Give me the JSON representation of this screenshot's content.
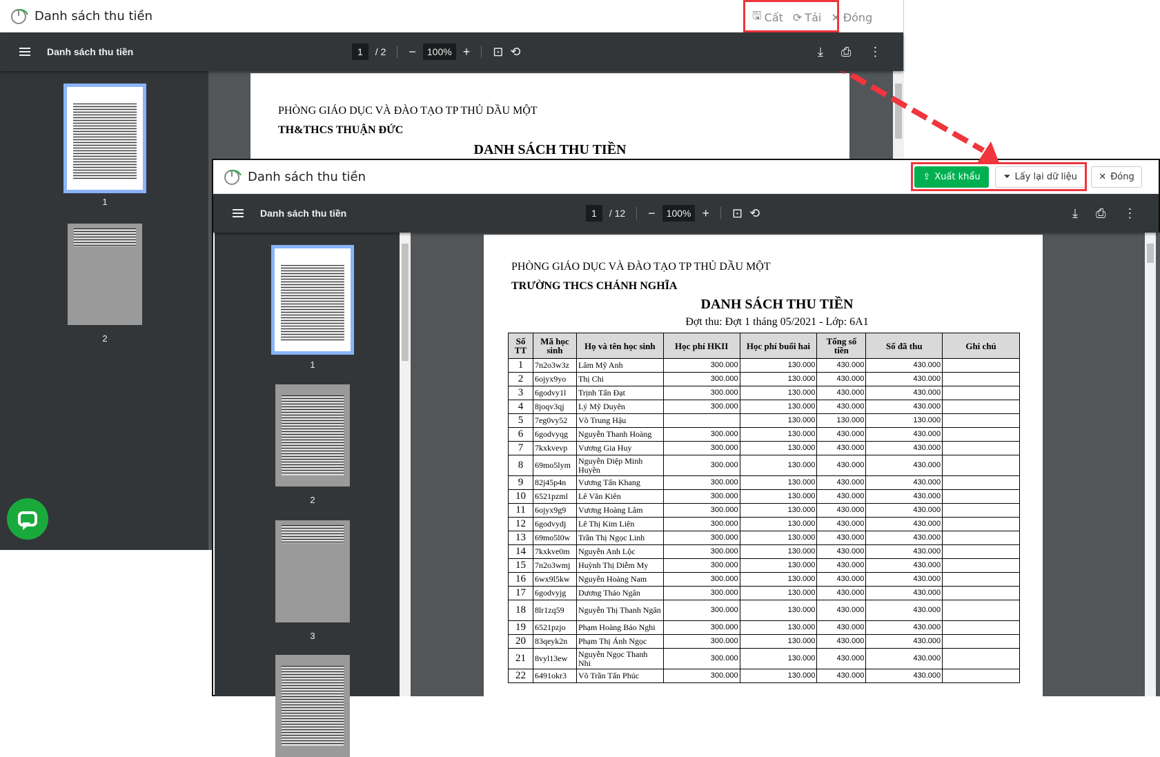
{
  "back_window": {
    "title": "Danh sách thu tiền",
    "actions": {
      "save": "Cất",
      "reload": "Tải",
      "close": "Đóng"
    },
    "toolbar": {
      "title": "Danh sách thu tiền",
      "page": "1",
      "total": "/ 2",
      "zoom": "100%"
    },
    "thumbnails": [
      "1",
      "2"
    ],
    "page": {
      "line1": "PHÒNG GIÁO DỤC VÀ ĐÀO TẠO TP THỦ DẦU MỘT",
      "line2": "TH&THCS THUẬN ĐỨC",
      "title": "DANH SÁCH THU TIỀN"
    }
  },
  "front_window": {
    "title": "Danh sách thu tiền",
    "actions": {
      "export": "Xuất khẩu",
      "reload": "Lấy lại dữ liệu",
      "close": "Đóng"
    },
    "toolbar": {
      "title": "Danh sách thu tiền",
      "page": "1",
      "total": "/ 12",
      "zoom": "100%"
    },
    "thumbnails": [
      "1",
      "2",
      "3"
    ],
    "page": {
      "line1": "PHÒNG GIÁO DỤC VÀ ĐÀO TẠO TP THỦ DẦU MỘT",
      "line2": "TRƯỜNG THCS CHÁNH NGHĨA",
      "title": "DANH SÁCH THU TIỀN",
      "subtitle": "Đợt thu: Đợt 1 tháng 05/2021 - Lớp: 6A1"
    },
    "table": {
      "columns": [
        "Số TT",
        "Mã học sinh",
        "Họ và tên học sinh",
        "Học phí HKII",
        "Học phí buổi hai",
        "Tổng số tiền",
        "Số đã thu",
        "Ghi chú"
      ],
      "rows": [
        [
          "1",
          "7n2o3w3z",
          "Lâm Mỹ Anh",
          "300.000",
          "130.000",
          "430.000",
          "430.000",
          ""
        ],
        [
          "2",
          "6ojyx9yo",
          "Thị Chi",
          "300.000",
          "130.000",
          "430.000",
          "430.000",
          ""
        ],
        [
          "3",
          "6godvy1l",
          "Trịnh Tấn Đạt",
          "300.000",
          "130.000",
          "430.000",
          "430.000",
          ""
        ],
        [
          "4",
          "8joqv3qj",
          "Lý Mỹ Duyên",
          "300.000",
          "130.000",
          "430.000",
          "430.000",
          ""
        ],
        [
          "5",
          "7eg0vy52",
          "Võ Trung Hậu",
          "",
          "130.000",
          "130.000",
          "130.000",
          ""
        ],
        [
          "6",
          "6godvyqg",
          "Nguyễn Thanh Hoàng",
          "300.000",
          "130.000",
          "430.000",
          "430.000",
          ""
        ],
        [
          "7",
          "7kxkvevp",
          "Vương Gia Huy",
          "300.000",
          "130.000",
          "430.000",
          "430.000",
          ""
        ],
        [
          "8",
          "69mo5lym",
          "Nguyễn Diệp Minh Huyền",
          "300.000",
          "130.000",
          "430.000",
          "430.000",
          ""
        ],
        [
          "9",
          "82j45p4n",
          "Vương Tấn Khang",
          "300.000",
          "130.000",
          "430.000",
          "430.000",
          ""
        ],
        [
          "10",
          "6521pzml",
          "Lê Văn Kiên",
          "300.000",
          "130.000",
          "430.000",
          "430.000",
          ""
        ],
        [
          "11",
          "6ojyx9g9",
          "Vương Hoàng Lâm",
          "300.000",
          "130.000",
          "430.000",
          "430.000",
          ""
        ],
        [
          "12",
          "6godvydj",
          "Lê Thị Kim Liên",
          "300.000",
          "130.000",
          "430.000",
          "430.000",
          ""
        ],
        [
          "13",
          "69mo5l0w",
          "Trần Thị Ngọc Linh",
          "300.000",
          "130.000",
          "430.000",
          "430.000",
          ""
        ],
        [
          "14",
          "7kxkve0m",
          "Nguyễn Anh Lộc",
          "300.000",
          "130.000",
          "430.000",
          "430.000",
          ""
        ],
        [
          "15",
          "7n2o3wmj",
          "Huỳnh Thị Diễm My",
          "300.000",
          "130.000",
          "430.000",
          "430.000",
          ""
        ],
        [
          "16",
          "6wx9l5kw",
          "Nguyễn Hoàng Nam",
          "300.000",
          "130.000",
          "430.000",
          "430.000",
          ""
        ],
        [
          "17",
          "6godvyjg",
          "Dương Thảo Ngân",
          "300.000",
          "130.000",
          "430.000",
          "430.000",
          ""
        ],
        [
          "18",
          "8lr1zq59",
          "Nguyễn Thị Thanh Ngân",
          "300.000",
          "130.000",
          "430.000",
          "430.000",
          ""
        ],
        [
          "19",
          "6521pzjo",
          "Phạm Hoàng Bảo Nghi",
          "300.000",
          "130.000",
          "430.000",
          "430.000",
          ""
        ],
        [
          "20",
          "83qeyk2n",
          "Phạm Thị Ánh Ngọc",
          "300.000",
          "130.000",
          "430.000",
          "430.000",
          ""
        ],
        [
          "21",
          "8vyl13ew",
          "Nguyễn Ngọc Thanh Nhi",
          "300.000",
          "130.000",
          "430.000",
          "430.000",
          ""
        ],
        [
          "22",
          "6491okr3",
          "Võ Trần Tấn Phúc",
          "300.000",
          "130.000",
          "430.000",
          "430.000",
          ""
        ]
      ]
    }
  },
  "colors": {
    "accent_green": "#00b050",
    "highlight_red": "#f0353c",
    "toolbar": "#323639"
  }
}
